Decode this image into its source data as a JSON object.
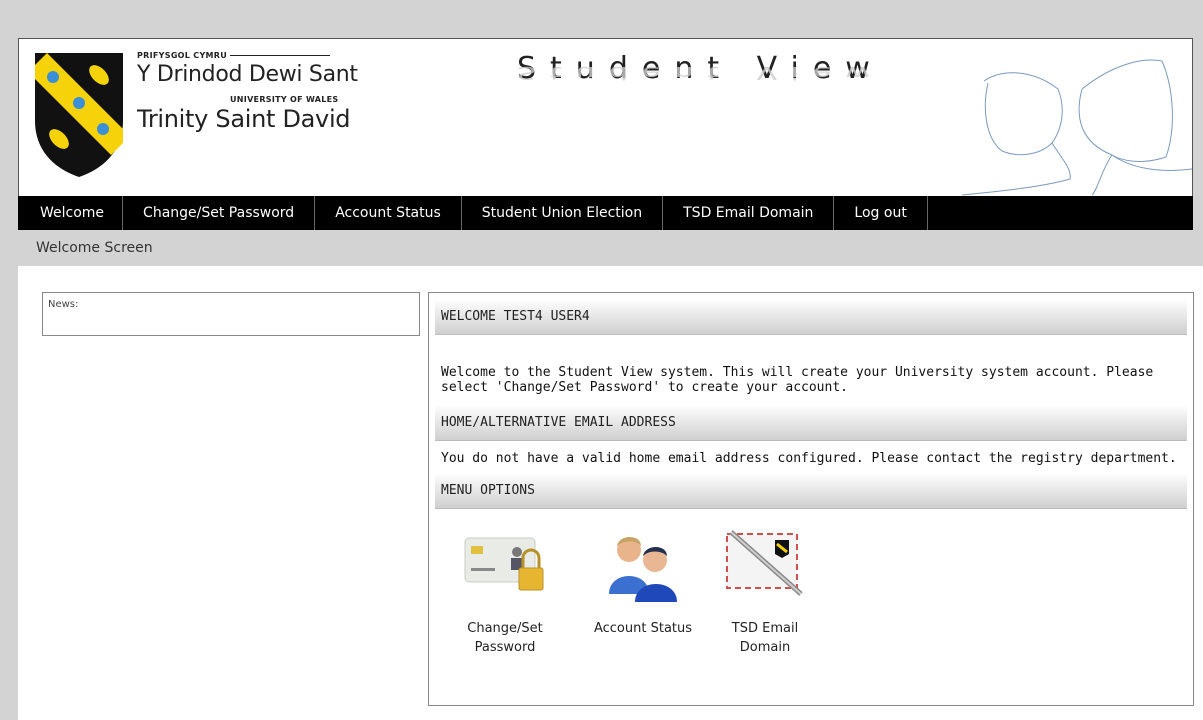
{
  "header": {
    "uni_top_small": "PRIFYSGOL CYMRU",
    "uni_welsh_name": "Y Drindod Dewi Sant",
    "uni_mid_small": "UNIVERSITY OF WALES",
    "uni_english_name": "Trinity Saint David",
    "app_title": "Student View"
  },
  "nav": {
    "items": [
      {
        "label": "Welcome"
      },
      {
        "label": "Change/Set Password"
      },
      {
        "label": "Account Status"
      },
      {
        "label": "Student Union Election"
      },
      {
        "label": "TSD Email Domain"
      },
      {
        "label": "Log out"
      }
    ]
  },
  "breadcrumb": "Welcome Screen",
  "news": {
    "label": "News:"
  },
  "welcome": {
    "heading": "WELCOME TEST4 USER4",
    "text": "Welcome to the Student View system. This will create your University system account. Please select 'Change/Set Password' to create your account."
  },
  "email": {
    "heading": "HOME/ALTERNATIVE EMAIL ADDRESS",
    "text": "You do not have a valid home email address configured. Please contact the registry department."
  },
  "menu": {
    "heading": "MENU OPTIONS",
    "options": [
      {
        "label": "Change/Set Password",
        "icon": "id-card-padlock-icon"
      },
      {
        "label": "Account Status",
        "icon": "users-icon"
      },
      {
        "label": "TSD Email Domain",
        "icon": "envelope-pen-icon"
      }
    ]
  },
  "colors": {
    "navbar_bg": "#000000",
    "page_bg": "#d3d3d3",
    "crest_black": "#111111",
    "crest_yellow": "#f5d20a",
    "crest_blue": "#3a8fd6"
  }
}
